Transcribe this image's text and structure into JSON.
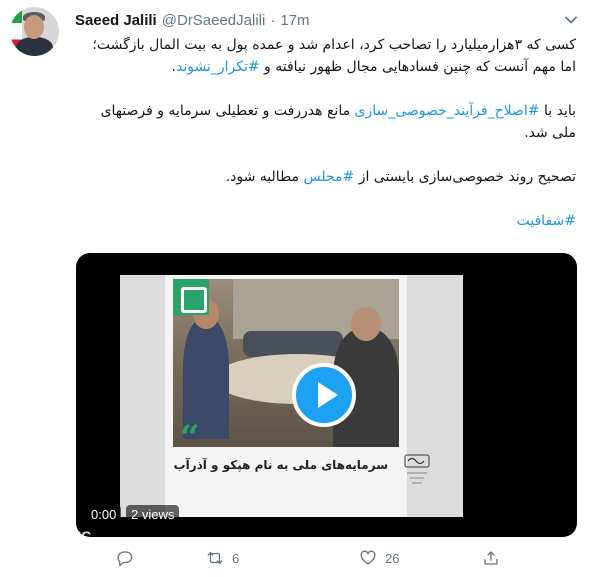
{
  "tweet": {
    "author_name": "Saeed Jalili",
    "handle": "@DrSaeedJalili",
    "separator": "·",
    "time": "17m",
    "paragraphs": [
      {
        "text": "کسی که ۳هزارمیلیارد را تصاحب کرد، اعدام شد و عمده پول به بیت المال بازگشت؛ اما مهم آنست که چنین فسادهایی مجال ظهور نیافته و ",
        "hashtag": "#تکرار_نشوند",
        "suffix": "."
      },
      {
        "prefix": "باید با ",
        "hashtag": "#اصلاح_فرآیند_خصوصی_سازی",
        "text": " مانع هدررفت و تعطیلی سرمایه و فرصتهای ملی شد."
      },
      {
        "prefix": "تصحیح روند خصوصی‌سازی بایستی از ",
        "hashtag": "#مجلس",
        "text": " مطالبه شود."
      }
    ],
    "footer_hashtag": "#شفافیت"
  },
  "video": {
    "caption": "سرمایه‌های ملی به نام هپکو و آذرآب",
    "duration": "0:00",
    "views": "2 views",
    "watermark": "YJC"
  },
  "actions": {
    "reply_count": "",
    "retweet_count": "6",
    "like_count": "26",
    "share_count": ""
  },
  "colors": {
    "link": "#1b95e0",
    "play_button": "#1da1f2",
    "secondary_text": "#657786",
    "accent_green": "#2aa36b"
  },
  "icons": [
    "chevron-down-icon",
    "reply-icon",
    "retweet-icon",
    "like-icon",
    "share-icon",
    "play-icon"
  ]
}
